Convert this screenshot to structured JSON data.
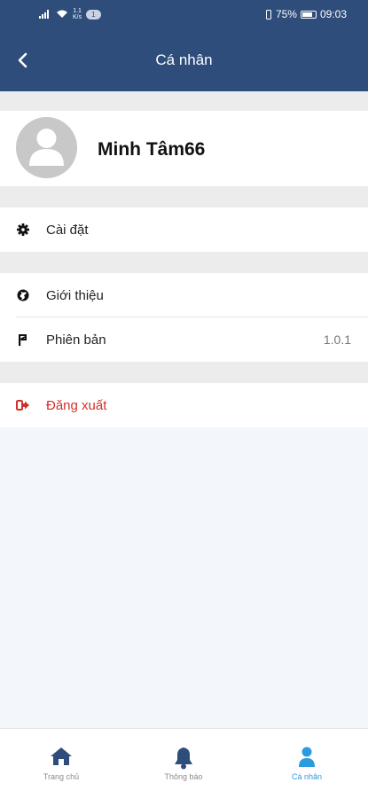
{
  "status_bar": {
    "network_speed_top": "1.1",
    "network_speed_bottom": "K/s",
    "badge": "1",
    "battery": "75%",
    "time": "09:03"
  },
  "header": {
    "title": "Cá nhân"
  },
  "profile": {
    "username": "Minh Tâm66"
  },
  "menu": {
    "settings_label": "Cài đặt",
    "about_label": "Giới thiệu",
    "version_label": "Phiên bản",
    "version_value": "1.0.1",
    "logout_label": "Đăng xuất"
  },
  "bottom_nav": {
    "items": [
      {
        "label": "Trang chủ",
        "icon": "home-icon"
      },
      {
        "label": "Thông báo",
        "icon": "bell-icon"
      },
      {
        "label": "Cá nhân",
        "icon": "person-icon"
      }
    ],
    "active_index": 2
  },
  "colors": {
    "header_bg": "#2e4d7b",
    "accent": "#2b9be0",
    "logout": "#d3302a",
    "nav_icon": "#2e4d7b"
  }
}
